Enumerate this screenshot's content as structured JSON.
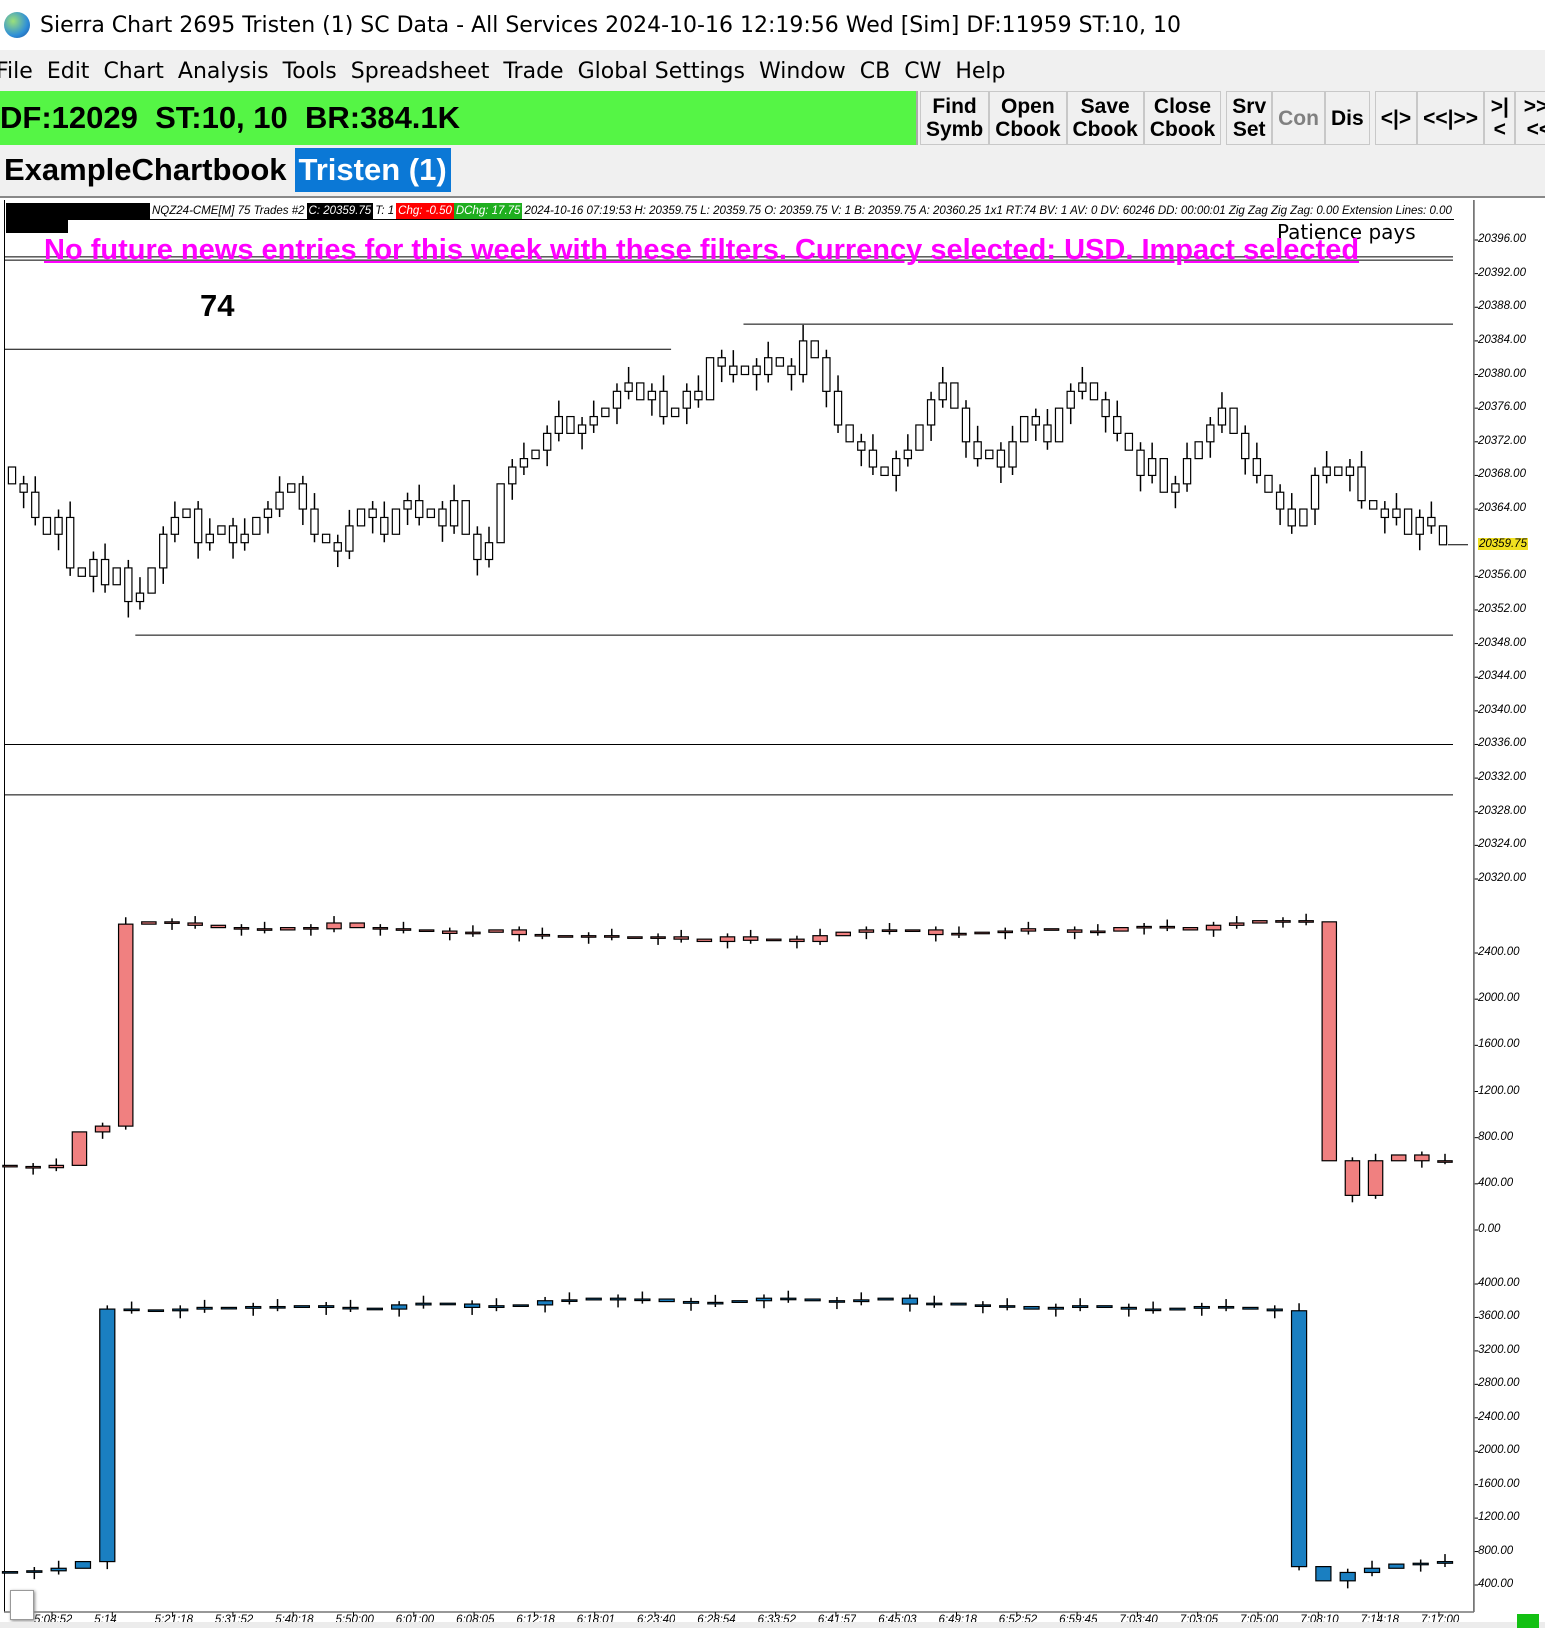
{
  "window": {
    "title": "Sierra Chart 2695 Tristen (1) SC Data - All Services 2024-10-16  12:19:56 Wed [Sim] DF:11959  ST:10, 10"
  },
  "menu": [
    "File",
    "Edit",
    "Chart",
    "Analysis",
    "Tools",
    "Spreadsheet",
    "Trade",
    "Global Settings",
    "Window",
    "CB",
    "CW",
    "Help"
  ],
  "statusbar": {
    "text": "DF:12029  ST:10, 10  BR:384.1K",
    "color": "#55f545"
  },
  "toolbar": [
    {
      "l1": "Find",
      "l2": "Symb"
    },
    {
      "l1": "Open",
      "l2": "Cbook"
    },
    {
      "l1": "Save",
      "l2": "Cbook"
    },
    {
      "l1": "Close",
      "l2": "Cbook"
    },
    {
      "l1": "Srv",
      "l2": "Set"
    },
    {
      "l1": "Con",
      "l2": "",
      "disabled": true
    },
    {
      "l1": "Dis",
      "l2": ""
    },
    {
      "l1": "<|>",
      "l2": ""
    },
    {
      "l1": "<<|>>",
      "l2": ""
    },
    {
      "l1": ">|<",
      "l2": ""
    },
    {
      "l1": ">>|<<",
      "l2": ""
    }
  ],
  "tabs": {
    "chartbook": "ExampleChartbook",
    "active": "Tristen (1)"
  },
  "chart_header": {
    "symbol": "NQZ24-CME[M]  75 Trades #2",
    "close": "C: 20359.75",
    "trades": "T: 1",
    "chg": "Chg: -0.50",
    "dchg": "DChg: 17.75",
    "rest": "2024-10-16 07:19:53 H: 20359.75 L: 20359.75 O: 20359.75 V: 1 B: 20359.75 A: 20360.25 1x1 RT:74 BV: 1 AV: 0 DV: 60246 DD: 00:00:01 Zig Zag  Zig Zag: 0.00  Extension Lines: 0.00"
  },
  "annotations": {
    "patience": "Patience pays",
    "news": "No future news entries for this week with these filters. Currency selected: USD. Impact selected",
    "trade_count": "74"
  },
  "chart_data": [
    {
      "type": "candlestick",
      "name": "price",
      "ylim": [
        20318,
        20398
      ],
      "yticks": [
        "20396.00",
        "20392.00",
        "20388.00",
        "20384.00",
        "20380.00",
        "20376.00",
        "20372.00",
        "20368.00",
        "20364.00",
        "20356.00",
        "20352.00",
        "20348.00",
        "20344.00",
        "20340.00",
        "20336.00",
        "20332.00",
        "20328.00",
        "20324.00",
        "20320.00"
      ],
      "ytick_values": [
        20396,
        20392,
        20388,
        20384,
        20380,
        20376,
        20372,
        20368,
        20364,
        20356,
        20352,
        20348,
        20344,
        20340,
        20336,
        20332,
        20328,
        20324,
        20320
      ],
      "current_price": "20359.75",
      "current_value": 20359.75,
      "first_open": 20369,
      "closes": [
        20367,
        20366,
        20363,
        20361,
        20363,
        20357,
        20356,
        20358,
        20355,
        20357,
        20353,
        20354,
        20357,
        20361,
        20363,
        20364,
        20360,
        20361,
        20362,
        20360,
        20361,
        20363,
        20364,
        20366,
        20367,
        20364,
        20361,
        20360,
        20359,
        20362,
        20364,
        20363,
        20361,
        20364,
        20365,
        20363,
        20364,
        20362,
        20365,
        20361,
        20358,
        20360,
        20367,
        20369,
        20370,
        20371,
        20373,
        20375,
        20373,
        20374,
        20375,
        20376,
        20378,
        20379,
        20377,
        20378,
        20375,
        20376,
        20378,
        20377,
        20382,
        20381,
        20380,
        20381,
        20380,
        20382,
        20381,
        20380,
        20384,
        20382,
        20378,
        20374,
        20372,
        20371,
        20369,
        20368,
        20370,
        20371,
        20374,
        20377,
        20379,
        20376,
        20372,
        20370,
        20371,
        20369,
        20372,
        20375,
        20374,
        20372,
        20376,
        20378,
        20379,
        20377,
        20375,
        20373,
        20371,
        20368,
        20370,
        20366,
        20367,
        20370,
        20372,
        20374,
        20376,
        20373,
        20370,
        20368,
        20366,
        20364,
        20362,
        20364,
        20368,
        20369,
        20368,
        20369,
        20365,
        20364,
        20363,
        20364,
        20361,
        20363,
        20362,
        20359.75
      ],
      "levels": [
        {
          "price": 20383,
          "from": 0.0,
          "to": 0.46
        },
        {
          "price": 20386,
          "from": 0.51,
          "to": 1.0
        },
        {
          "price": 20349,
          "from": 0.09,
          "to": 1.0
        },
        {
          "price": 20336,
          "from": 0.0,
          "to": 1.0
        },
        {
          "price": 20330,
          "from": 0.0,
          "to": 1.0
        },
        {
          "price": 20394,
          "from": 0.0,
          "to": 1.0
        },
        {
          "price": 20393.6,
          "from": 0.0,
          "to": 1.0
        }
      ]
    },
    {
      "type": "candlestick",
      "name": "study-red",
      "color": "#f08080",
      "ylim": [
        -100,
        2900
      ],
      "yticks": [
        "2400.00",
        "2000.00",
        "1600.00",
        "1200.00",
        "800.00",
        "400.00",
        "0.00"
      ],
      "ytick_values": [
        2400,
        2000,
        1600,
        1200,
        800,
        400,
        0
      ],
      "first_open": 560,
      "closes": [
        550,
        540,
        560,
        850,
        900,
        2650,
        2670,
        2660,
        2640,
        2620,
        2610,
        2600,
        2620,
        2610,
        2660,
        2620,
        2610,
        2600,
        2590,
        2570,
        2580,
        2600,
        2560,
        2550,
        2540,
        2550,
        2540,
        2530,
        2540,
        2520,
        2500,
        2540,
        2510,
        2520,
        2500,
        2550,
        2580,
        2600,
        2590,
        2600,
        2560,
        2570,
        2580,
        2590,
        2610,
        2600,
        2580,
        2590,
        2620,
        2630,
        2620,
        2600,
        2640,
        2660,
        2680,
        2680,
        2670,
        600,
        300,
        600,
        650,
        600,
        600
      ]
    },
    {
      "type": "candlestick",
      "name": "study-blue",
      "color": "#1a7fc1",
      "ylim": [
        300,
        4100
      ],
      "yticks": [
        "4000.00",
        "3600.00",
        "3200.00",
        "2800.00",
        "2400.00",
        "2000.00",
        "1600.00",
        "1200.00",
        "800.00",
        "400.00"
      ],
      "ytick_values": [
        4000,
        3600,
        3200,
        2800,
        2400,
        2000,
        1600,
        1200,
        800,
        400
      ],
      "first_open": 550,
      "closes": [
        560,
        570,
        600,
        680,
        3700,
        3690,
        3680,
        3700,
        3720,
        3710,
        3730,
        3720,
        3740,
        3720,
        3710,
        3700,
        3750,
        3770,
        3760,
        3720,
        3740,
        3750,
        3800,
        3810,
        3830,
        3810,
        3820,
        3790,
        3770,
        3780,
        3800,
        3830,
        3820,
        3800,
        3790,
        3810,
        3830,
        3760,
        3770,
        3750,
        3740,
        3730,
        3700,
        3720,
        3740,
        3720,
        3700,
        3690,
        3710,
        3730,
        3720,
        3700,
        3680,
        620,
        450,
        550,
        600,
        650,
        660,
        680
      ]
    }
  ],
  "time_axis": [
    "5:08:52",
    "5:14",
    "5:21:18",
    "5:31:52",
    "5:40:18",
    "5:50:00",
    "6:01:00",
    "6:08:05",
    "6:12:18",
    "6:18:01",
    "6:23:40",
    "6:28:54",
    "6:33:52",
    "6:41:57",
    "6:45:03",
    "6:49:18",
    "6:52:52",
    "6:59:45",
    "7:03:40",
    "7:03:05",
    "7:05:00",
    "7:08:10",
    "7:14:18",
    "7:17:00"
  ]
}
